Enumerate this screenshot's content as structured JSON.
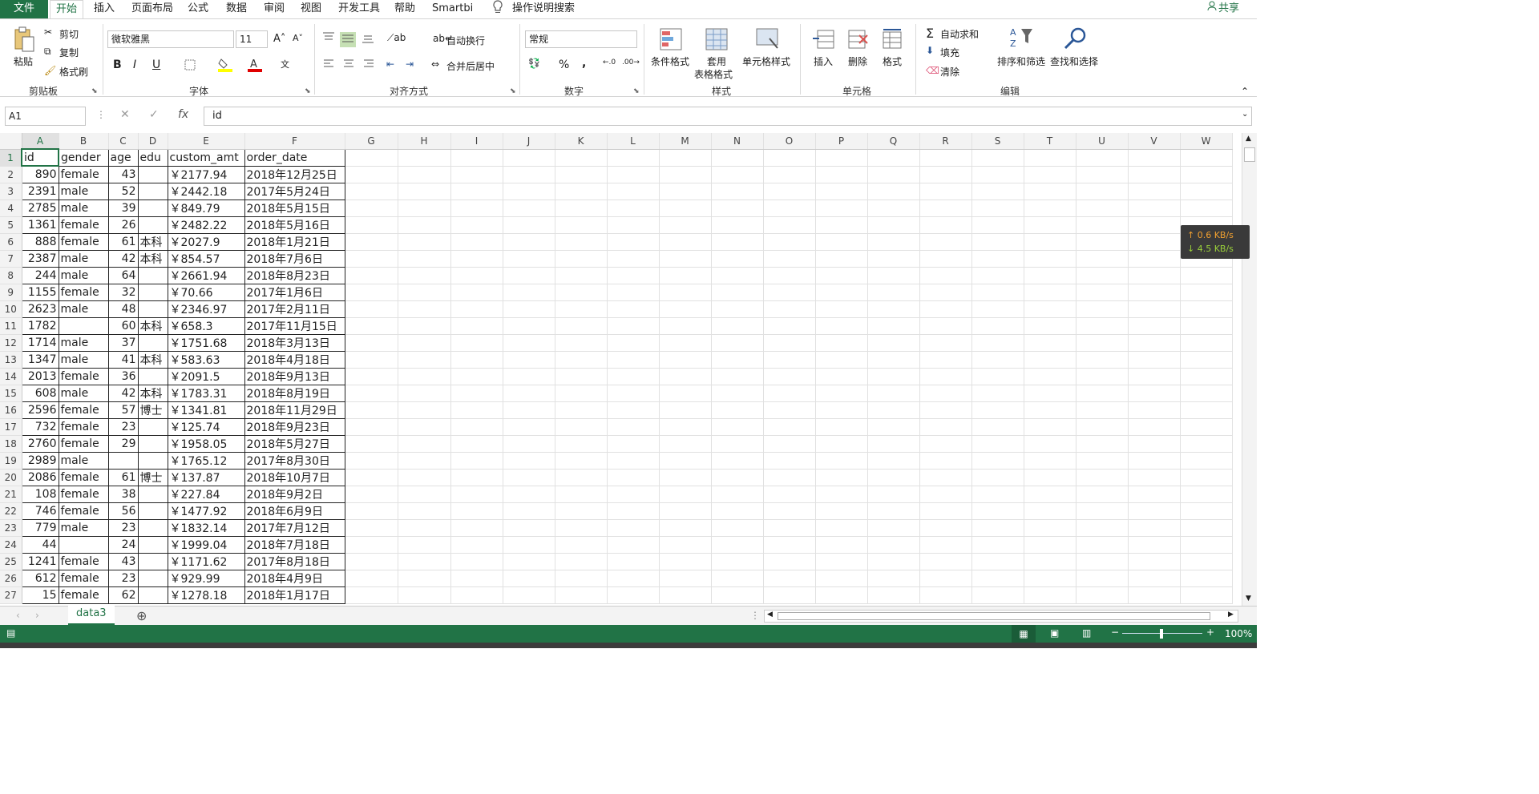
{
  "tabs": {
    "file": "文件",
    "home": "开始",
    "insert": "插入",
    "layout": "页面布局",
    "formula": "公式",
    "data": "数据",
    "review": "审阅",
    "view": "视图",
    "dev": "开发工具",
    "help": "帮助",
    "smartbi": "Smartbi",
    "search": "操作说明搜索",
    "share": "共享"
  },
  "clipboard": {
    "paste": "粘贴",
    "cut": "剪切",
    "copy": "复制",
    "painter": "格式刷",
    "label": "剪贴板"
  },
  "font": {
    "name": "微软雅黑",
    "size": "11",
    "bold": "B",
    "italic": "I",
    "underline": "U",
    "label": "字体",
    "font_color_glyph": "A"
  },
  "align": {
    "wrap": "自动换行",
    "merge": "合并后居中",
    "label": "对齐方式"
  },
  "number": {
    "format": "常规",
    "percent": "%",
    "comma": ",",
    "label": "数字"
  },
  "styles": {
    "cond": "条件格式",
    "table1": "套用",
    "table2": "表格格式",
    "cell": "单元格样式",
    "label": "样式"
  },
  "cells": {
    "insert": "插入",
    "delete": "删除",
    "format": "格式",
    "label": "单元格"
  },
  "edit": {
    "autosum": "自动求和",
    "fill": "填充",
    "clear": "清除",
    "sort": "排序和筛选",
    "find": "查找和选择",
    "label": "编辑"
  },
  "formula_bar": {
    "name_box": "A1",
    "fx": "fx",
    "value": "id"
  },
  "columns": [
    "A",
    "B",
    "C",
    "D",
    "E",
    "F",
    "G",
    "H",
    "I",
    "J",
    "K",
    "L",
    "M",
    "N",
    "O",
    "P",
    "Q",
    "R",
    "S",
    "T",
    "U",
    "V",
    "W"
  ],
  "header": [
    "id",
    "gender",
    "age",
    "edu",
    "custom_amt",
    "order_date"
  ],
  "rows": [
    [
      "890",
      "female",
      "43",
      "",
      "￥2177.94",
      "2018年12月25日"
    ],
    [
      "2391",
      "male",
      "52",
      "",
      "￥2442.18",
      "2017年5月24日"
    ],
    [
      "2785",
      "male",
      "39",
      "",
      "￥849.79",
      "2018年5月15日"
    ],
    [
      "1361",
      "female",
      "26",
      "",
      "￥2482.22",
      "2018年5月16日"
    ],
    [
      "888",
      "female",
      "61",
      "本科",
      "￥2027.9",
      "2018年1月21日"
    ],
    [
      "2387",
      "male",
      "42",
      "本科",
      "￥854.57",
      "2018年7月6日"
    ],
    [
      "244",
      "male",
      "64",
      "",
      "￥2661.94",
      "2018年8月23日"
    ],
    [
      "1155",
      "female",
      "32",
      "",
      "￥70.66",
      "2017年1月6日"
    ],
    [
      "2623",
      "male",
      "48",
      "",
      "￥2346.97",
      "2017年2月11日"
    ],
    [
      "1782",
      "",
      "60",
      "本科",
      "￥658.3",
      "2017年11月15日"
    ],
    [
      "1714",
      "male",
      "37",
      "",
      "￥1751.68",
      "2018年3月13日"
    ],
    [
      "1347",
      "male",
      "41",
      "本科",
      "￥583.63",
      "2018年4月18日"
    ],
    [
      "2013",
      "female",
      "36",
      "",
      "￥2091.5",
      "2018年9月13日"
    ],
    [
      "608",
      "male",
      "42",
      "本科",
      "￥1783.31",
      "2018年8月19日"
    ],
    [
      "2596",
      "female",
      "57",
      "博士",
      "￥1341.81",
      "2018年11月29日"
    ],
    [
      "732",
      "female",
      "23",
      "",
      "￥125.74",
      "2018年9月23日"
    ],
    [
      "2760",
      "female",
      "29",
      "",
      "￥1958.05",
      "2018年5月27日"
    ],
    [
      "2989",
      "male",
      "",
      "",
      "￥1765.12",
      "2017年8月30日"
    ],
    [
      "2086",
      "female",
      "61",
      "博士",
      "￥137.87",
      "2018年10月7日"
    ],
    [
      "108",
      "female",
      "38",
      "",
      "￥227.84",
      "2018年9月2日"
    ],
    [
      "746",
      "female",
      "56",
      "",
      "￥1477.92",
      "2018年6月9日"
    ],
    [
      "779",
      "male",
      "23",
      "",
      "￥1832.14",
      "2017年7月12日"
    ],
    [
      "44",
      "",
      "24",
      "",
      "￥1999.04",
      "2018年7月18日"
    ],
    [
      "1241",
      "female",
      "43",
      "",
      "￥1171.62",
      "2017年8月18日"
    ],
    [
      "612",
      "female",
      "23",
      "",
      "￥929.99",
      "2018年4月9日"
    ],
    [
      "15",
      "female",
      "62",
      "",
      "￥1278.18",
      "2018年1月17日"
    ]
  ],
  "sheet_tab": "data3",
  "zoom": "100%",
  "net": {
    "up": "↑ 0.6 KB/s",
    "down": "↓ 4.5 KB/s"
  },
  "colors": {
    "accent": "#217346"
  }
}
